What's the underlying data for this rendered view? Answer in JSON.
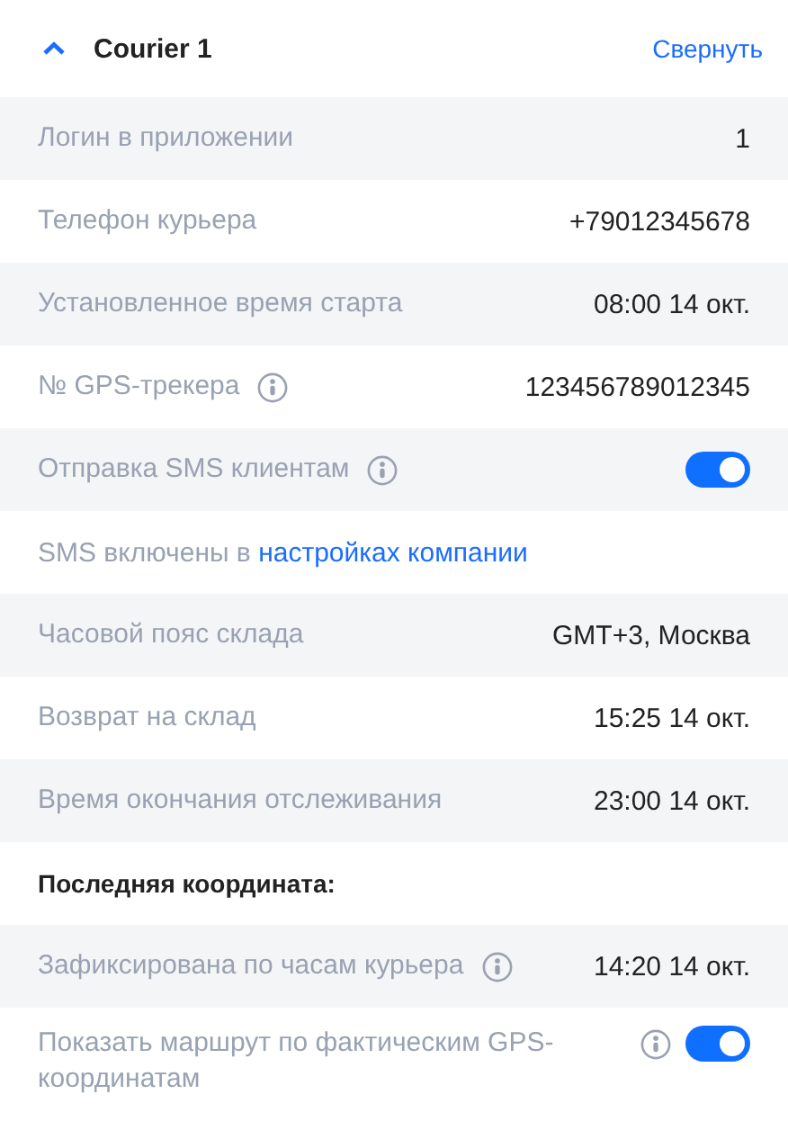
{
  "header": {
    "title": "Courier 1",
    "expanded": true,
    "collapse_link": "Свернуть"
  },
  "rows": [
    {
      "kind": "field",
      "label": "Логин в приложении",
      "value": "1",
      "info": false
    },
    {
      "kind": "field",
      "label": "Телефон курьера",
      "value": "+79012345678",
      "info": false
    },
    {
      "kind": "field",
      "label": "Установленное время старта",
      "value": "08:00 14 окт.",
      "info": false
    },
    {
      "kind": "field",
      "label": "№ GPS-трекера",
      "value": "123456789012345",
      "info": true
    },
    {
      "kind": "toggle",
      "label": "Отправка SMS клиентам",
      "info": true,
      "on": true
    },
    {
      "kind": "note",
      "text": "SMS включены в",
      "link": "настройках компании"
    },
    {
      "kind": "field",
      "label": "Часовой пояс склада",
      "value": "GMT+3, Москва",
      "info": false
    },
    {
      "kind": "field",
      "label": "Возврат на склад",
      "value": "15:25 14 окт.",
      "info": false
    },
    {
      "kind": "field",
      "label": "Время окончания отслеживания",
      "value": "23:00 14 окт.",
      "info": false
    },
    {
      "kind": "heading",
      "text": "Последняя координата:"
    },
    {
      "kind": "field",
      "label": "Зафиксирована по часам курьера",
      "value": "14:20 14 окт.",
      "info": true
    },
    {
      "kind": "toggle",
      "label": "Показать маршрут по фактическим GPS-координатам",
      "info": true,
      "on": true
    }
  ]
}
